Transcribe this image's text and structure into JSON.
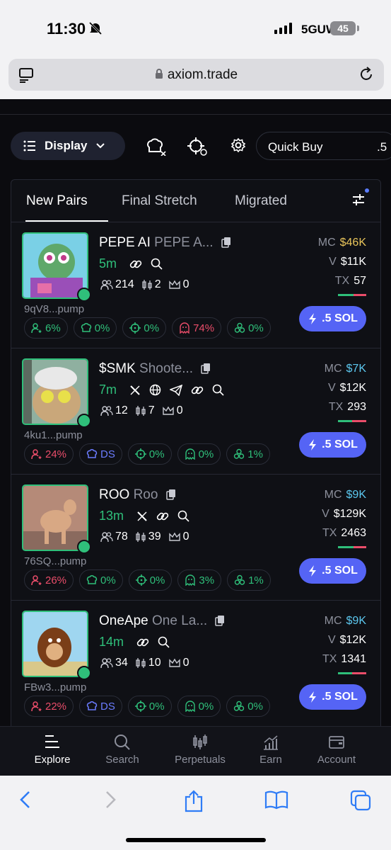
{
  "status_bar": {
    "time": "11:30",
    "network": "5GUW",
    "battery": "45"
  },
  "browser": {
    "url": "axiom.trade"
  },
  "toolbar": {
    "display_label": "Display",
    "quick_buy_label": "Quick Buy",
    "quick_buy_value": ".5"
  },
  "tabs": [
    {
      "label": "New Pairs"
    },
    {
      "label": "Final Stretch"
    },
    {
      "label": "Migrated"
    }
  ],
  "tokens": [
    {
      "symbol": "PEPE AI",
      "name": "PEPE A...",
      "age": "5m",
      "address": "9qV8...pump",
      "holders": "214",
      "bundles": "2",
      "kol": "0",
      "mc_label": "MC",
      "mc": "$46K",
      "mc_color": "#e8c45a",
      "vol_label": "V",
      "vol": "$11K",
      "tx_label": "TX",
      "tx": "57",
      "chips": [
        {
          "text": "6%",
          "color": "green",
          "icon": "user-star"
        },
        {
          "text": "0%",
          "color": "green",
          "icon": "chef"
        },
        {
          "text": "0%",
          "color": "green",
          "icon": "crosshair"
        },
        {
          "text": "74%",
          "color": "red",
          "icon": "ghost"
        },
        {
          "text": "0%",
          "color": "green",
          "icon": "cluster"
        }
      ],
      "buy_label": ".5 SOL"
    },
    {
      "symbol": "$SMK",
      "name": "Shoote...",
      "age": "7m",
      "address": "4ku1...pump",
      "holders": "12",
      "bundles": "7",
      "kol": "0",
      "mc_label": "MC",
      "mc": "$7K",
      "mc_color": "#5cc8f0",
      "vol_label": "V",
      "vol": "$12K",
      "tx_label": "TX",
      "tx": "293",
      "chips": [
        {
          "text": "24%",
          "color": "red",
          "icon": "user-star"
        },
        {
          "text": "DS",
          "color": "blue",
          "icon": "chef"
        },
        {
          "text": "0%",
          "color": "green",
          "icon": "crosshair"
        },
        {
          "text": "0%",
          "color": "green",
          "icon": "ghost"
        },
        {
          "text": "1%",
          "color": "green",
          "icon": "cluster"
        }
      ],
      "buy_label": ".5 SOL"
    },
    {
      "symbol": "ROO",
      "name": "Roo",
      "age": "13m",
      "address": "76SQ...pump",
      "holders": "78",
      "bundles": "39",
      "kol": "0",
      "mc_label": "MC",
      "mc": "$9K",
      "mc_color": "#5cc8f0",
      "vol_label": "V",
      "vol": "$129K",
      "tx_label": "TX",
      "tx": "2463",
      "chips": [
        {
          "text": "26%",
          "color": "red",
          "icon": "user-star"
        },
        {
          "text": "0%",
          "color": "green",
          "icon": "chef"
        },
        {
          "text": "0%",
          "color": "green",
          "icon": "crosshair"
        },
        {
          "text": "3%",
          "color": "green",
          "icon": "ghost"
        },
        {
          "text": "1%",
          "color": "green",
          "icon": "cluster"
        }
      ],
      "buy_label": ".5 SOL"
    },
    {
      "symbol": "OneApe",
      "name": "One La...",
      "age": "14m",
      "address": "FBw3...pump",
      "holders": "34",
      "bundles": "10",
      "kol": "0",
      "mc_label": "MC",
      "mc": "$9K",
      "mc_color": "#5cc8f0",
      "vol_label": "V",
      "vol": "$12K",
      "tx_label": "TX",
      "tx": "1341",
      "chips": [
        {
          "text": "22%",
          "color": "red",
          "icon": "user-star"
        },
        {
          "text": "DS",
          "color": "blue",
          "icon": "chef"
        },
        {
          "text": "0%",
          "color": "green",
          "icon": "crosshair"
        },
        {
          "text": "0%",
          "color": "green",
          "icon": "ghost"
        },
        {
          "text": "0%",
          "color": "green",
          "icon": "cluster"
        }
      ],
      "buy_label": ".5 SOL"
    }
  ],
  "bottom_nav": [
    {
      "label": "Explore"
    },
    {
      "label": "Search"
    },
    {
      "label": "Perpetuals"
    },
    {
      "label": "Earn"
    },
    {
      "label": "Account"
    }
  ],
  "colors": {
    "accent": "#5564f5",
    "green": "#2fbf7a",
    "red": "#ea4d6a",
    "background": "#0b0b0f"
  }
}
